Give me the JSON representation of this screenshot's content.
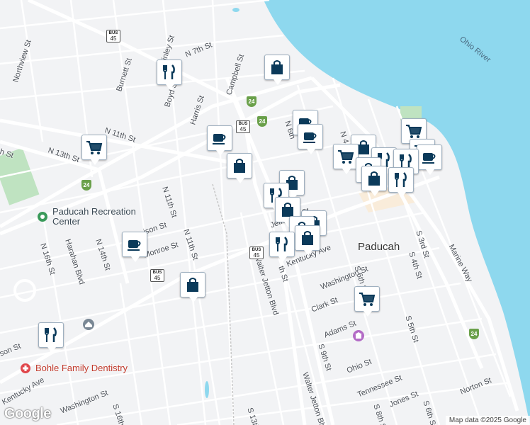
{
  "map": {
    "river_label": "Ohio River",
    "city_label": "Paducah",
    "places": {
      "recreation_center": "Paducah Recreation Center",
      "dentistry": "Bohle Family Dentistry"
    },
    "streets": {
      "n7th": "N 7th St",
      "finley": "Finley St",
      "campbell": "Campbell St",
      "burnett": "Burnett St",
      "boyd": "Boyd St",
      "harris": "Harris St",
      "northview": "Northview St",
      "n11th_top": "N 11th St",
      "n13th": "N 13th St",
      "n11th_mid": "N 11th St",
      "n11th_low": "N 11th St",
      "n16th": "N 16th St",
      "n14th": "N 14th St",
      "harahan": "Harahan Blvd",
      "madison": "ison St",
      "monroe": "Monroe St",
      "jefferson": "Jefferson St",
      "kentucky": "Kentucky Ave",
      "washington": "Washington St",
      "clark": "Clark St",
      "adams": "Adams St",
      "s6th": "S 6th St",
      "s4th": "S 4th St",
      "s3rd": "S 3rd St",
      "s5th": "S 5th St",
      "s9th": "S 9th St",
      "walter_jetton_1": "Walter Jetton Blvd",
      "walter_jetton_2": "Walter Jetton Blvd",
      "s8th": "th St",
      "marine": "Marine Way",
      "ohio": "Ohio St",
      "tennessee": "Tennessee St",
      "norton": "Norton St",
      "jones": "Jones St",
      "s6th_low": "S 6th St",
      "s8th_low": "S 8th St",
      "washington_low": "Washington St",
      "s16th": "S 16th St",
      "s13th": "S 13th",
      "kentucky_low": "Kentucky Ave",
      "jackson_left": "son St",
      "h_st_left": "h St",
      "n6th": "N 6th",
      "n4th": "N 4"
    },
    "shields": {
      "bus45_top": "45",
      "bus45_mid": "45",
      "bus45_low": "45",
      "bus45_center": "45",
      "bus_label": "BUS",
      "i24_a": "24",
      "i24_b": "24",
      "i24_c": "24",
      "i24_d": "24"
    },
    "pois": [
      {
        "type": "restaurant",
        "icon": "fork-knife-icon"
      },
      {
        "type": "shopping",
        "icon": "shopping-bag-icon"
      },
      {
        "type": "cafe",
        "icon": "coffee-cup-icon"
      },
      {
        "type": "grocery",
        "icon": "shopping-cart-icon"
      },
      {
        "type": "shopping",
        "icon": "shopping-bag-icon"
      },
      {
        "type": "cafe",
        "icon": "coffee-cup-icon"
      },
      {
        "type": "restaurant",
        "icon": "fork-knife-icon"
      },
      {
        "type": "shopping",
        "icon": "shopping-bag-icon"
      },
      {
        "type": "grocery",
        "icon": "shopping-cart-icon"
      },
      {
        "type": "grocery",
        "icon": "shopping-cart-icon"
      },
      {
        "type": "shopping",
        "icon": "shopping-bag-icon"
      },
      {
        "type": "restaurant",
        "icon": "fork-knife-icon"
      },
      {
        "type": "cafe",
        "icon": "coffee-cup-icon"
      },
      {
        "type": "shopping",
        "icon": "shopping-bag-icon"
      },
      {
        "type": "restaurant",
        "icon": "fork-knife-icon"
      },
      {
        "type": "grocery",
        "icon": "shopping-cart-icon"
      },
      {
        "type": "restaurant",
        "icon": "fork-knife-icon"
      },
      {
        "type": "shopping",
        "icon": "shopping-bag-icon"
      }
    ],
    "colors": {
      "water": "#8ed8ee",
      "land": "#f2f3f5",
      "road": "#ffffff",
      "poi_icon": "#0b3a5a",
      "park": "#bfe3c1"
    }
  },
  "branding": {
    "logo": "Google",
    "attribution": "Map data ©2025 Google"
  }
}
